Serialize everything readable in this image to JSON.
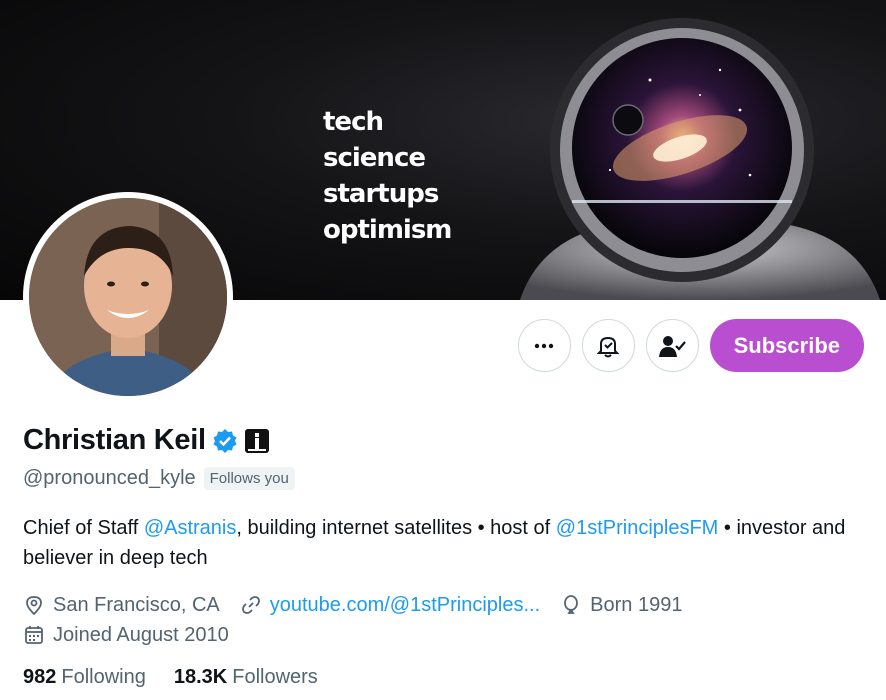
{
  "banner": {
    "words": [
      "tech",
      "science",
      "startups",
      "optimism"
    ]
  },
  "profile": {
    "display_name": "Christian Keil",
    "handle": "@pronounced_kyle",
    "follows_you": "Follows you",
    "bio_parts": {
      "p1": "Chief of Staff ",
      "mention1": "@Astranis",
      "p2": ", building internet satellites • host of ",
      "mention2": "@1stPrinciplesFM",
      "p3": " • investor and believer in deep tech"
    },
    "location": "San Francisco, CA",
    "website": "youtube.com/@1stPrinciples...",
    "born": "Born 1991",
    "joined": "Joined August 2010",
    "following_count": "982",
    "following_label": "Following",
    "followers_count": "18.3K",
    "followers_label": "Followers"
  },
  "actions": {
    "more_icon": "more-icon",
    "notify_icon": "bell-icon",
    "following_icon": "user-check-icon",
    "subscribe_label": "Subscribe"
  },
  "colors": {
    "subscribe": "#b94fd0",
    "link": "#1d9bf0",
    "verified": "#1d9bf0"
  }
}
